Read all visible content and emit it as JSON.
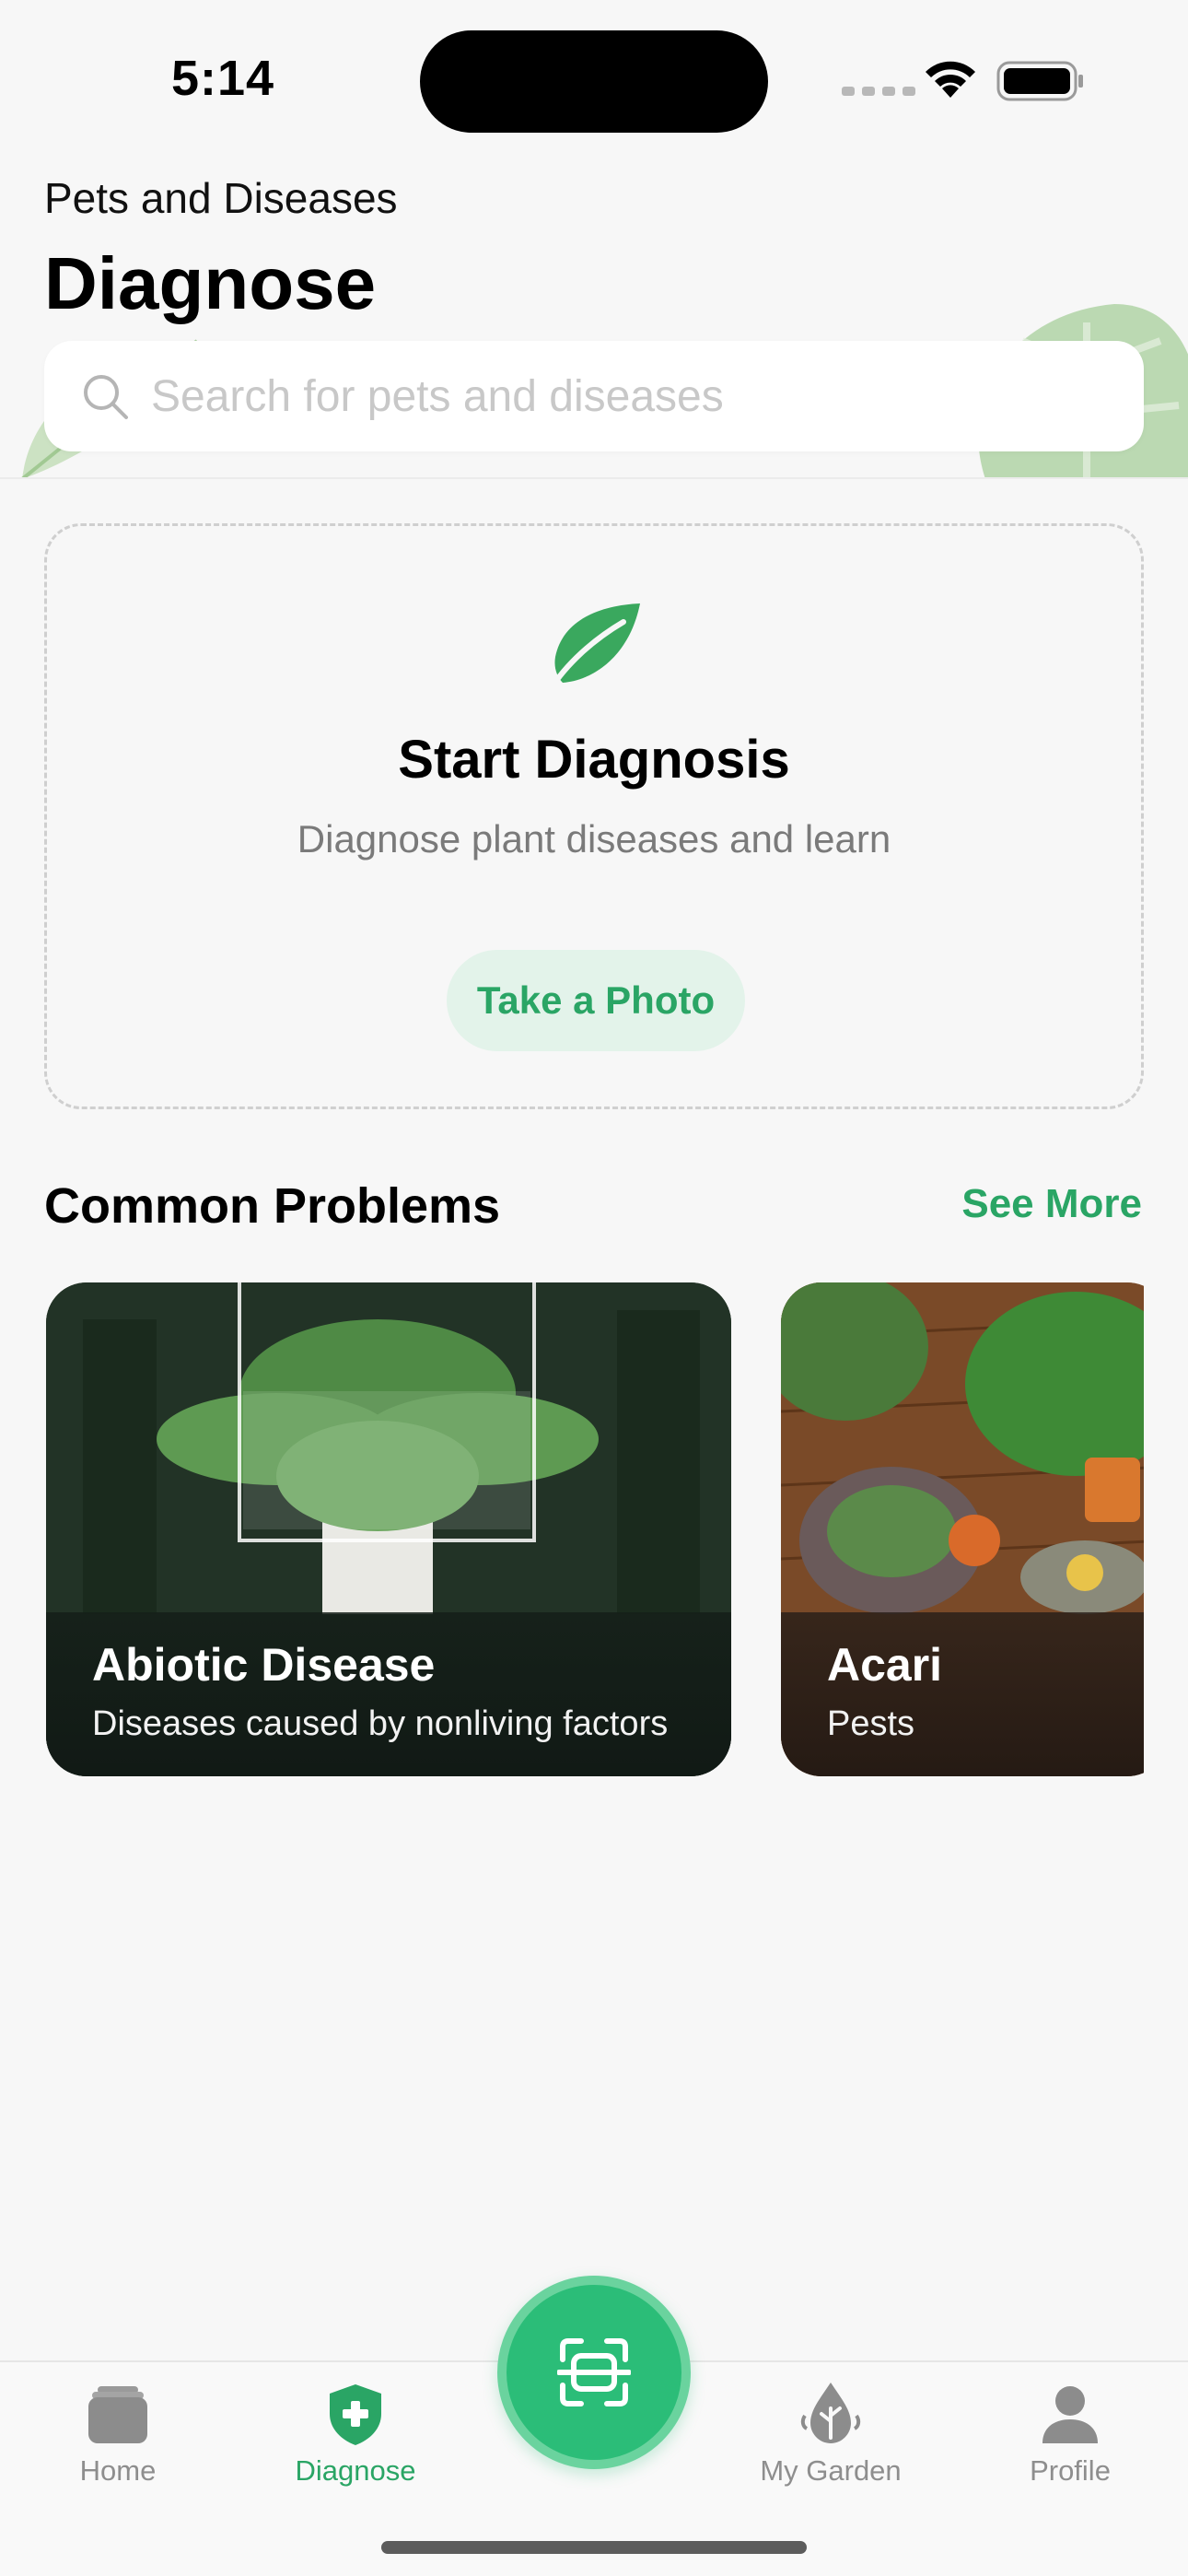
{
  "status_bar": {
    "time": "5:14"
  },
  "header": {
    "subtitle": "Pets and Diseases",
    "title": "Diagnose",
    "search_placeholder": "Search for pets and diseases"
  },
  "diagnosis": {
    "title": "Start Diagnosis",
    "subtitle": "Diagnose plant diseases and learn",
    "button_label": "Take a Photo"
  },
  "common_problems": {
    "title": "Common Problems",
    "see_more": "See More",
    "cards": [
      {
        "title": "Abiotic Disease",
        "description": "Diseases caused by nonliving factors"
      },
      {
        "title": "Acari",
        "description": "Pests"
      }
    ]
  },
  "tab_bar": {
    "items": [
      {
        "label": "Home",
        "icon": "home-icon",
        "active": false
      },
      {
        "label": "Diagnose",
        "icon": "shield-plus-icon",
        "active": true
      },
      {
        "label": "My Garden",
        "icon": "plant-drop-icon",
        "active": false
      },
      {
        "label": "Profile",
        "icon": "person-icon",
        "active": false
      }
    ],
    "scan_icon": "scan-icon"
  },
  "colors": {
    "accent": "#2aa565",
    "accent_light": "#e3f3ea",
    "scan_button": "#2bbd78",
    "background": "#f7f7f7"
  }
}
